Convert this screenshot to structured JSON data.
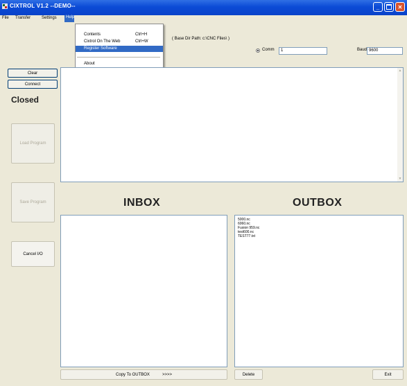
{
  "window": {
    "title": "CIXTROL V1.2 --DEMO--",
    "icon": "app-icon",
    "controls": [
      "minimize-icon",
      "maximize-icon",
      "close-icon"
    ]
  },
  "menu": {
    "items": [
      "File",
      "Transfer",
      "Settings",
      "Help"
    ],
    "active": "Help"
  },
  "dropdown": {
    "items": [
      {
        "label": "Contents",
        "shortcut": "Ctrl+H"
      },
      {
        "label": "Cixtrol On The Web",
        "shortcut": "Ctrl+W"
      },
      {
        "label": "Register Software",
        "shortcut": ""
      },
      {
        "label": "About",
        "shortcut": ""
      }
    ],
    "highlighted": "Register Software"
  },
  "connection": {
    "base_dir_label": "( Base Dir Path:  c:\\CNC Files\\ )",
    "comm_label": "Comm",
    "comm_value": "1",
    "baud_label": "Baud",
    "baud_value": "9600"
  },
  "left_panel": {
    "clear": "Clear",
    "connect": "Connect",
    "status": "Closed",
    "load_program": "Load Program",
    "save_program": "Save Program",
    "cancel_io": "Cancel I/O"
  },
  "inbox": {
    "title": "INBOX",
    "files": []
  },
  "outbox": {
    "title": "OUTBOX",
    "files": [
      "5000.nc",
      "6060.nc",
      "Fusion 959.nc",
      "test600.nc",
      "TEST77.txt"
    ]
  },
  "footer": {
    "copy_to_outbox": "Copy To OUTBOX",
    "arrows": ">>>>",
    "delete": "Delete",
    "exit": "Exit"
  },
  "colors": {
    "titlebar": "#0b4bd6",
    "highlight": "#316ac5",
    "window_bg": "#ece9d8"
  }
}
